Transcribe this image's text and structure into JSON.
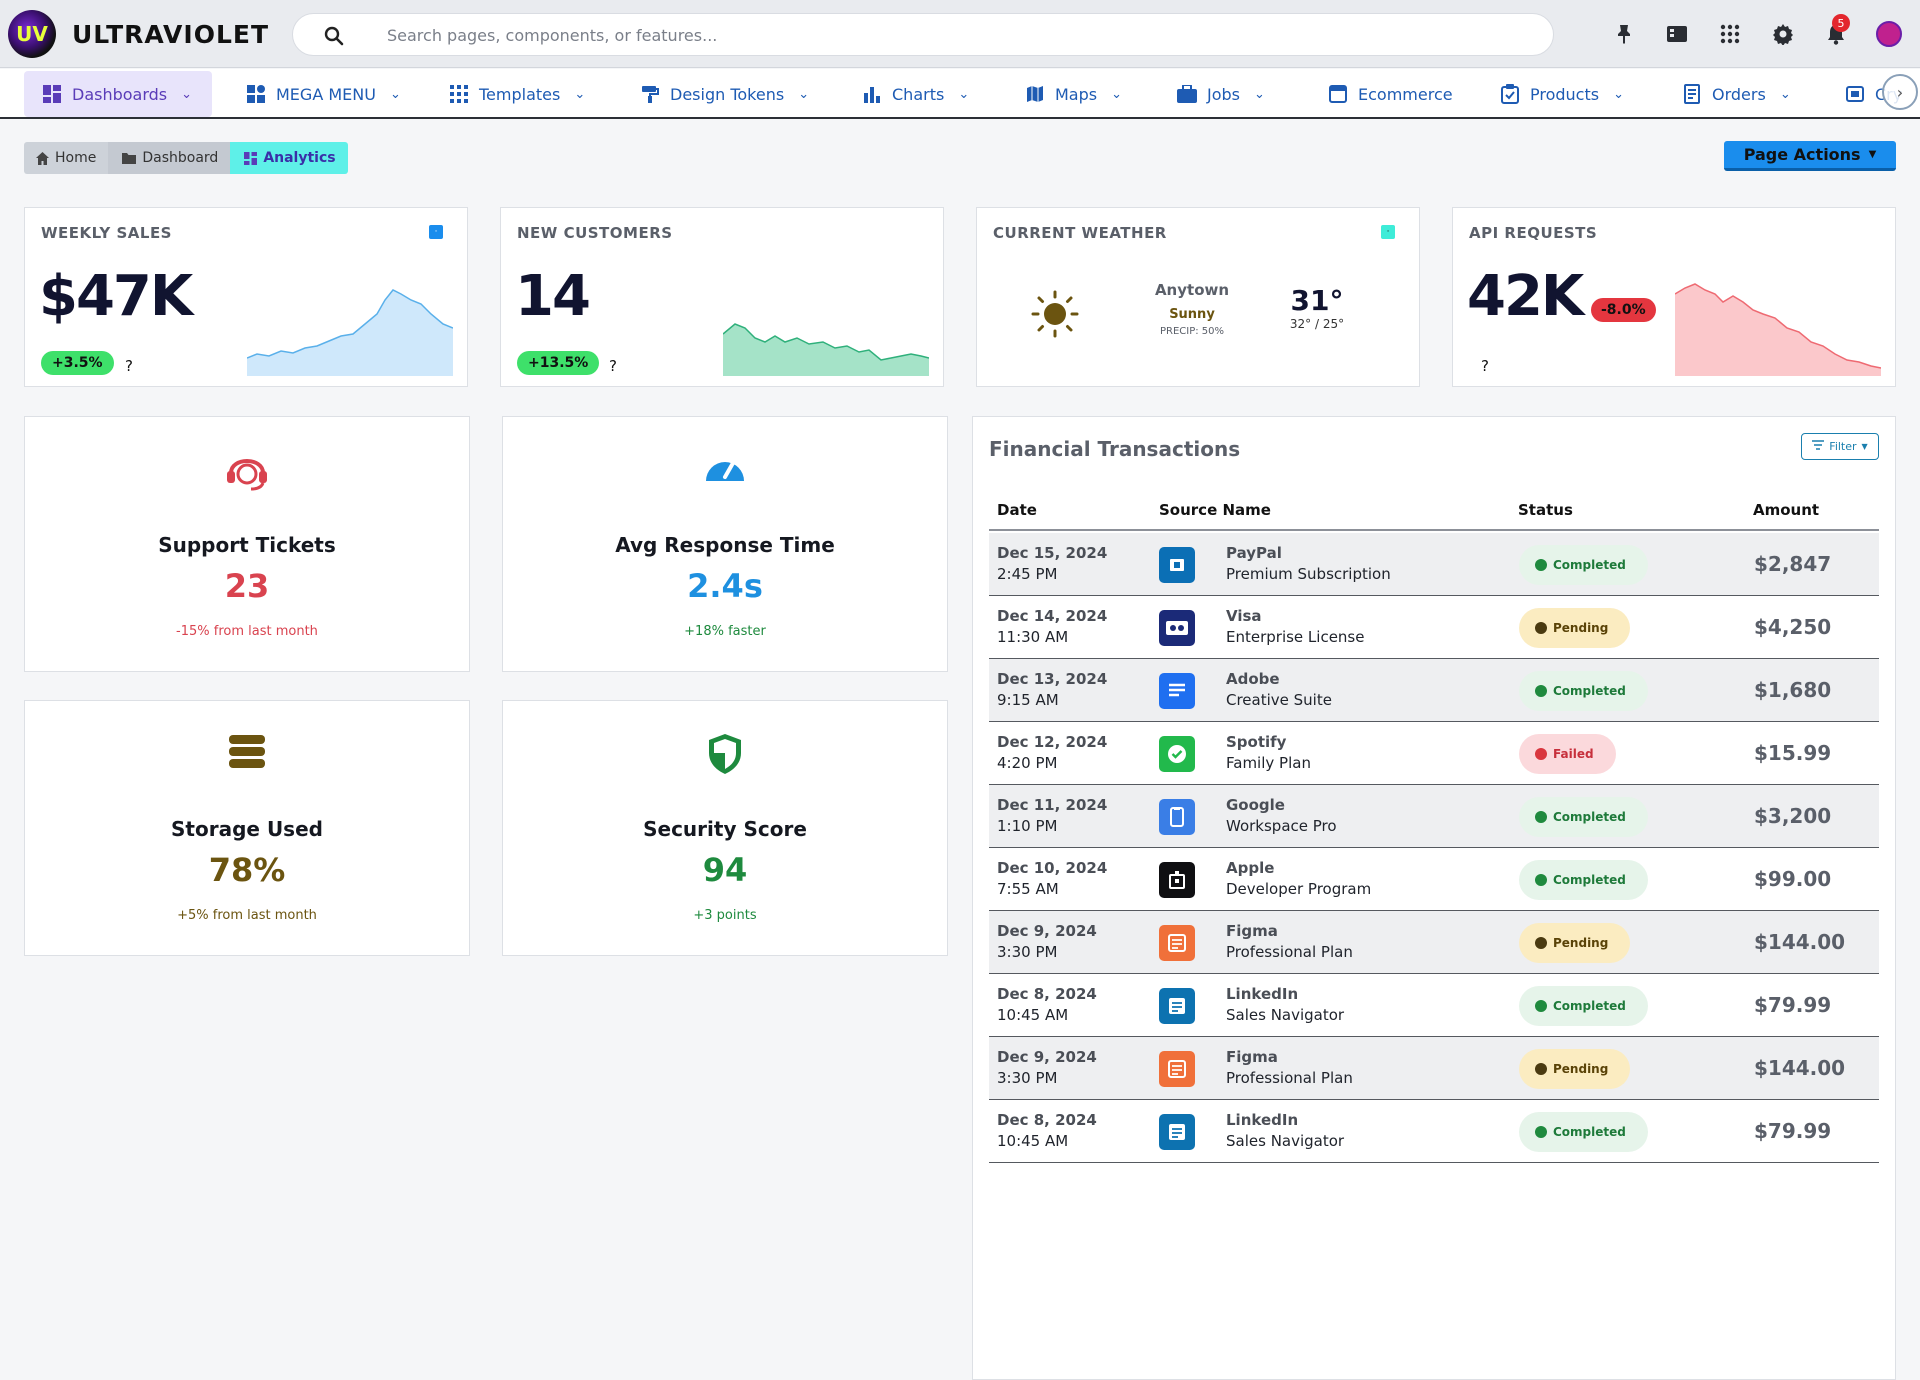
{
  "header": {
    "brand": "ULTRAVIOLET",
    "logo_text": "UV",
    "search_placeholder": "Search pages, components, or features...",
    "icons": [
      "pin-icon",
      "book-icon",
      "apps-grid-icon",
      "gear-icon",
      "bell-icon",
      "user-avatar"
    ],
    "notification_count": "5"
  },
  "nav": {
    "items": [
      {
        "label": "Dashboards",
        "icon": "dashboard-icon",
        "active": true
      },
      {
        "label": "MEGA MENU",
        "icon": "mega-menu-icon"
      },
      {
        "label": "Templates",
        "icon": "templates-grid-icon"
      },
      {
        "label": "Design Tokens",
        "icon": "paint-roller-icon"
      },
      {
        "label": "Charts",
        "icon": "bar-chart-icon"
      },
      {
        "label": "Maps",
        "icon": "map-icon"
      },
      {
        "label": "Jobs",
        "icon": "briefcase-icon"
      },
      {
        "label": "Ecommerce",
        "icon": "store-icon"
      },
      {
        "label": "Products",
        "icon": "clipboard-check-icon"
      },
      {
        "label": "Orders",
        "icon": "receipt-icon"
      },
      {
        "label": "Cry",
        "icon": "crypto-icon"
      }
    ]
  },
  "breadcrumb": {
    "items": [
      "Home",
      "Dashboard",
      "Analytics"
    ],
    "page_actions": "Page Actions"
  },
  "stats": {
    "weekly_sales": {
      "label": "WEEKLY SALES",
      "value": "$47K",
      "change": "+3.5%",
      "help": "?"
    },
    "new_customers": {
      "label": "NEW CUSTOMERS",
      "value": "14",
      "change": "+13.5%",
      "help": "?"
    },
    "weather": {
      "label": "CURRENT WEATHER",
      "city": "Anytown",
      "condition": "Sunny",
      "precip": "PRECIP: 50%",
      "temp": "31°",
      "range": "32° / 25°"
    },
    "api_requests": {
      "label": "API REQUESTS",
      "value": "42K",
      "change": "-8.0%",
      "help": "?"
    }
  },
  "cards": {
    "support": {
      "title": "Support Tickets",
      "value": "23",
      "sub": "-15% from last month",
      "icon": "headset-icon",
      "color": "#d9434f"
    },
    "response": {
      "title": "Avg Response Time",
      "value": "2.4s",
      "sub": "+18% faster",
      "icon": "speedometer-icon",
      "color": "#1e90e0"
    },
    "storage": {
      "title": "Storage Used",
      "value": "78%",
      "sub": "+5% from last month",
      "icon": "database-icon",
      "color": "#6b5410"
    },
    "security": {
      "title": "Security Score",
      "value": "94",
      "sub": "+3 points",
      "icon": "shield-icon",
      "color": "#1e8a3e"
    }
  },
  "transactions": {
    "title": "Financial Transactions",
    "filter_label": "Filter",
    "columns": [
      "Date",
      "Source Name",
      "Status",
      "Amount"
    ],
    "rows": [
      {
        "date": "Dec 15, 2024",
        "time": "2:45 PM",
        "name": "PayPal",
        "desc": "Premium Subscription",
        "status": "Completed",
        "amount": "$2,847",
        "icon": "paypal-icon",
        "icon_bg": "#0b6fb5"
      },
      {
        "date": "Dec 14, 2024",
        "time": "11:30 AM",
        "name": "Visa",
        "desc": "Enterprise License",
        "status": "Pending",
        "amount": "$4,250",
        "icon": "visa-card-icon",
        "icon_bg": "#1b2a78"
      },
      {
        "date": "Dec 13, 2024",
        "time": "9:15 AM",
        "name": "Adobe",
        "desc": "Creative Suite",
        "status": "Completed",
        "amount": "$1,680",
        "icon": "adobe-doc-icon",
        "icon_bg": "#1f6ff0"
      },
      {
        "date": "Dec 12, 2024",
        "time": "4:20 PM",
        "name": "Spotify",
        "desc": "Family Plan",
        "status": "Failed",
        "amount": "$15.99",
        "icon": "spotify-check-icon",
        "icon_bg": "#22b94c"
      },
      {
        "date": "Dec 11, 2024",
        "time": "1:10 PM",
        "name": "Google",
        "desc": "Workspace Pro",
        "status": "Completed",
        "amount": "$3,200",
        "icon": "google-device-icon",
        "icon_bg": "#3a7ee6"
      },
      {
        "date": "Dec 10, 2024",
        "time": "7:55 AM",
        "name": "Apple",
        "desc": "Developer Program",
        "status": "Completed",
        "amount": "$99.00",
        "icon": "apple-bag-icon",
        "icon_bg": "#0f0f12"
      },
      {
        "date": "Dec 9, 2024",
        "time": "3:30 PM",
        "name": "Figma",
        "desc": "Professional Plan",
        "status": "Pending",
        "amount": "$144.00",
        "icon": "figma-doc-icon",
        "icon_bg": "#f0703a"
      },
      {
        "date": "Dec 8, 2024",
        "time": "10:45 AM",
        "name": "LinkedIn",
        "desc": "Sales Navigator",
        "status": "Completed",
        "amount": "$79.99",
        "icon": "linkedin-doc-icon",
        "icon_bg": "#0d72b0"
      },
      {
        "date": "Dec 9, 2024",
        "time": "3:30 PM",
        "name": "Figma",
        "desc": "Professional Plan",
        "status": "Pending",
        "amount": "$144.00",
        "icon": "figma-doc-icon",
        "icon_bg": "#f0703a"
      },
      {
        "date": "Dec 8, 2024",
        "time": "10:45 AM",
        "name": "LinkedIn",
        "desc": "Sales Navigator",
        "status": "Completed",
        "amount": "$79.99",
        "icon": "linkedin-doc-icon",
        "icon_bg": "#0d72b0"
      }
    ]
  }
}
